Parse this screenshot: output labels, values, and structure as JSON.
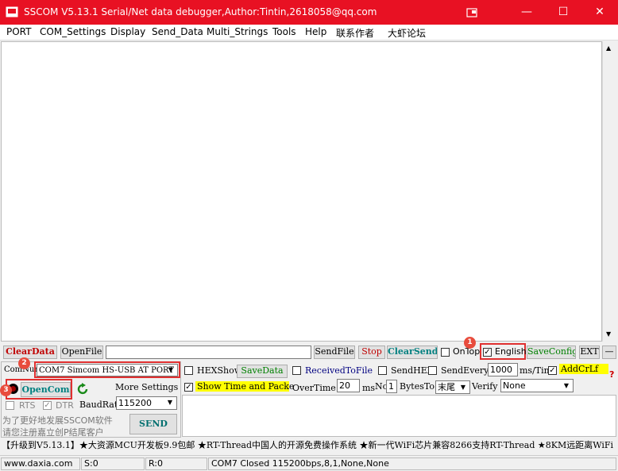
{
  "window": {
    "title": "SSCOM V5.13.1 Serial/Net data debugger,Author:Tintin,2618058@qq.com"
  },
  "menu": [
    "PORT",
    "COM_Settings",
    "Display",
    "Send_Data",
    "Multi_Strings",
    "Tools",
    "Help",
    "联系作者",
    "大虾论坛"
  ],
  "row1": {
    "clear_data": "ClearData",
    "open_file": "OpenFile",
    "file_path": "",
    "send_file": "SendFile",
    "stop": "Stop",
    "clear_send": "ClearSend",
    "on_top": "OnTop",
    "english": "English",
    "save_config": "SaveConfig",
    "ext": "EXT",
    "minus": "—"
  },
  "port": {
    "label": "ComNum",
    "value": "COM7 Simcom HS-USB AT PORT",
    "open_com": "OpenCom",
    "more_settings": "More Settings",
    "rts": "RTS",
    "dtr": "DTR",
    "baud_label": "BaudRat",
    "baud_value": "115200",
    "promo_line1": "为了更好地发展SSCOM软件",
    "promo_line2": "请您注册嘉立创P结尾客户"
  },
  "options": {
    "hex_show": "HEXShow",
    "save_data": "SaveData",
    "received_to_file": "ReceivedToFile",
    "send_hex": "SendHEX",
    "send_every": "SendEvery:",
    "send_every_value": "1000",
    "ms_tim": "ms/Tim",
    "add_crlf": "AddCrLf",
    "show_time": "Show Time and Packe",
    "overtime": "OverTime:",
    "overtime_value": "20",
    "ms": "ms",
    "no": "No",
    "no_value": "1",
    "bytes_to": "BytesTo",
    "bytes_to_value": "末尾",
    "verify": "Verify",
    "verify_value": "None",
    "question": "?"
  },
  "send_button": "SEND",
  "badges": [
    "1",
    "2",
    "3"
  ],
  "ticker": "【升级到V5.13.1】★大资源MCU开发板9.9包邮 ★RT-Thread中国人的开源免费操作系统 ★新一代WiFi芯片兼容8266支持RT-Thread ★8KM远距离WiFi",
  "status": {
    "url": "www.daxia.com",
    "s": "S:0",
    "r": "R:0",
    "info": "COM7 Closed  115200bps,8,1,None,None"
  },
  "colors": {
    "titlebar": "#e81123",
    "highlight": "#ffff00",
    "annotation": "#e03030"
  }
}
